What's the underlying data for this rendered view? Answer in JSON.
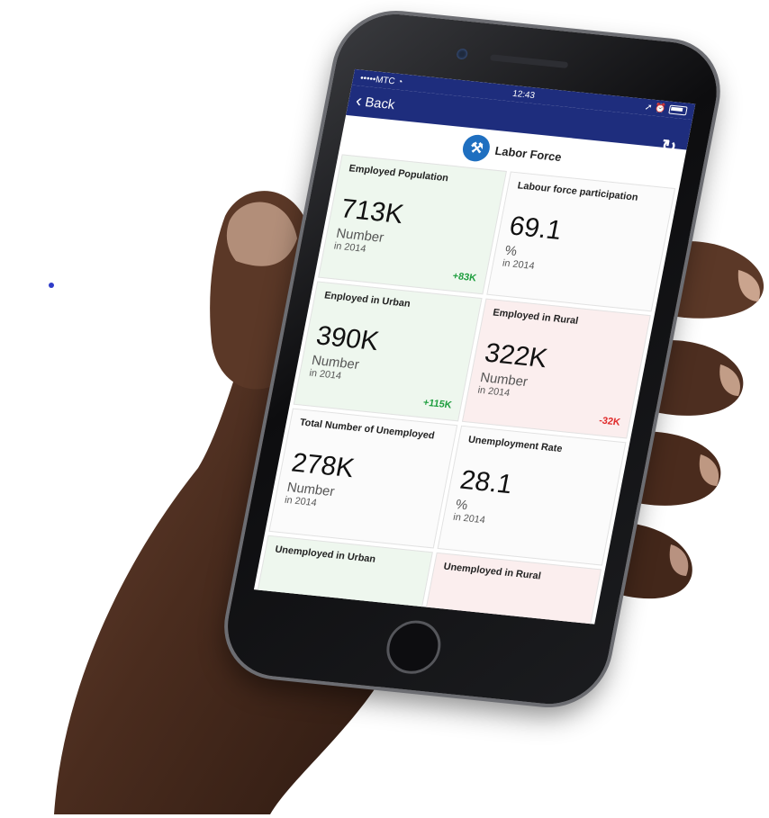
{
  "status_bar": {
    "carrier": "•••••MTC",
    "wifi_icon": "wifi-icon",
    "time": "12:43",
    "right_icons": "➚ ⏰"
  },
  "nav": {
    "back_label": "Back",
    "refresh_icon": "refresh-icon"
  },
  "header": {
    "title": "Labor Force",
    "logo_icon": "tools-icon"
  },
  "cards": [
    {
      "title": "Employed Population",
      "value": "713K",
      "unit": "Number",
      "year": "in 2014",
      "delta": "+83K",
      "trend": "up"
    },
    {
      "title": "Labour force participation",
      "value": "69.1",
      "unit": "%",
      "year": "in 2014",
      "delta": "",
      "trend": "neutral"
    },
    {
      "title": "Enployed in Urban",
      "value": "390K",
      "unit": "Number",
      "year": "in 2014",
      "delta": "+115K",
      "trend": "up"
    },
    {
      "title": "Employed in Rural",
      "value": "322K",
      "unit": "Number",
      "year": "in 2014",
      "delta": "-32K",
      "trend": "down"
    },
    {
      "title": "Total Number of Unemployed",
      "value": "278K",
      "unit": "Number",
      "year": "in 2014",
      "delta": "",
      "trend": "neutral"
    },
    {
      "title": "Unemployment Rate",
      "value": "28.1",
      "unit": "%",
      "year": "in 2014",
      "delta": "",
      "trend": "neutral"
    },
    {
      "title": "Unemployed in Urban",
      "value": "",
      "unit": "",
      "year": "",
      "delta": "",
      "trend": "up"
    },
    {
      "title": "Unemployed in Rural",
      "value": "",
      "unit": "",
      "year": "",
      "delta": "",
      "trend": "down"
    }
  ],
  "colors": {
    "nav_blue": "#1e2d7d",
    "positive": "#1e9e3e",
    "negative": "#e02a2a",
    "skin": "#5a3a2a"
  }
}
